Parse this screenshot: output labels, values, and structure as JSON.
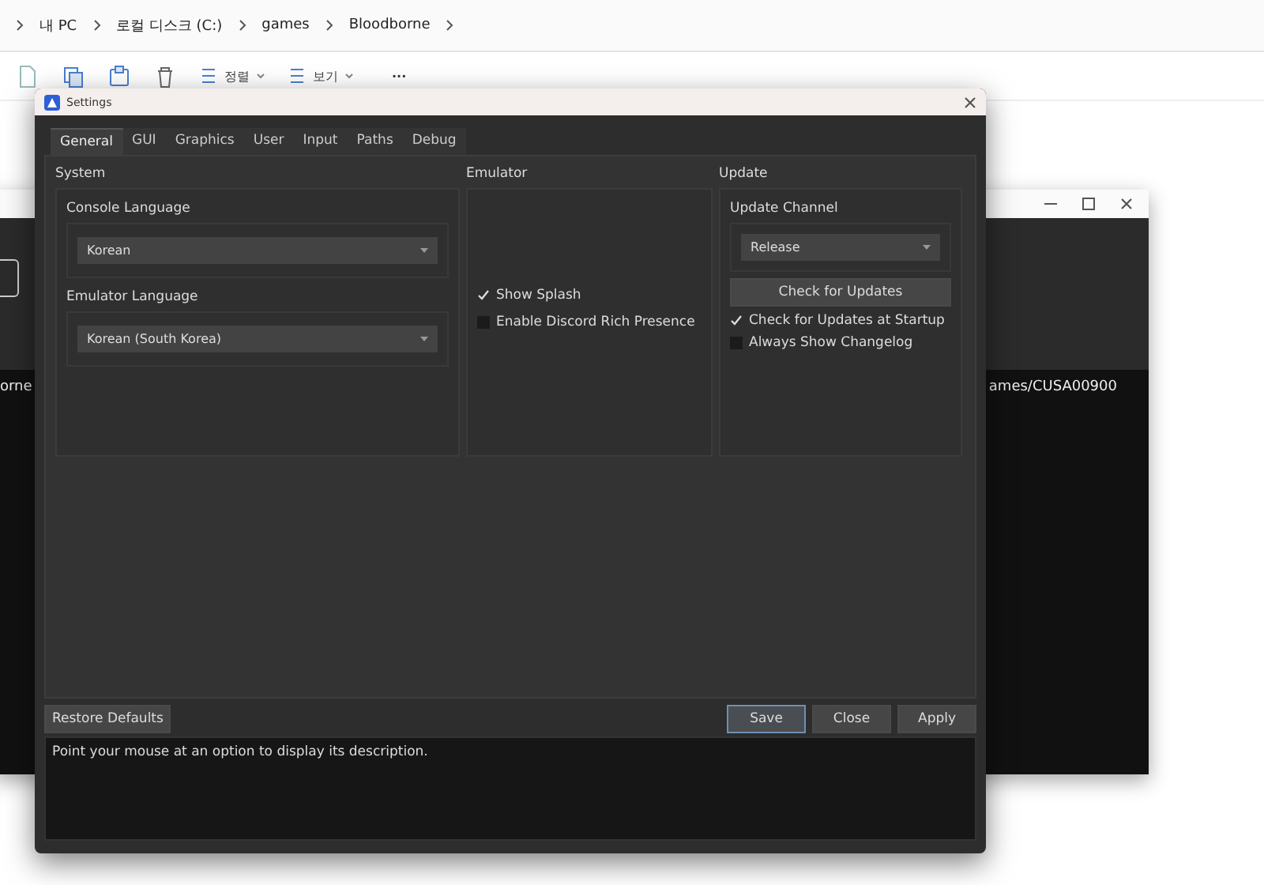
{
  "explorer": {
    "breadcrumb": [
      "내 PC",
      "로컬 디스크 (C:)",
      "games",
      "Bloodborne"
    ],
    "toolbar": [
      {
        "kind": "new"
      },
      {
        "kind": "copy"
      },
      {
        "kind": "paste"
      },
      {
        "kind": "delete"
      },
      {
        "kind": "menu",
        "label": "정렬"
      },
      {
        "kind": "menu",
        "label": "보기"
      },
      {
        "kind": "more",
        "label": "···"
      }
    ]
  },
  "background_window": {
    "texts": [
      "orne",
      "ames/CUSA00900"
    ]
  },
  "settings": {
    "title": "Settings",
    "tabs": [
      {
        "label": "General",
        "selected": true
      },
      {
        "label": "GUI",
        "selected": false
      },
      {
        "label": "Graphics",
        "selected": false
      },
      {
        "label": "User",
        "selected": false
      },
      {
        "label": "Input",
        "selected": false
      },
      {
        "label": "Paths",
        "selected": false
      },
      {
        "label": "Debug",
        "selected": false
      }
    ],
    "system": {
      "title": "System",
      "console_language": {
        "label": "Console Language",
        "value": "Korean"
      },
      "emulator_language": {
        "label": "Emulator Language",
        "value": "Korean (South Korea)"
      }
    },
    "emulator": {
      "title": "Emulator",
      "options": [
        {
          "label": "Show Splash",
          "checked": true
        },
        {
          "label": "Enable Discord Rich Presence",
          "checked": false
        }
      ]
    },
    "update": {
      "title": "Update",
      "channel": {
        "label": "Update Channel",
        "value": "Release"
      },
      "check_button": "Check for Updates",
      "options": [
        {
          "label": "Check for Updates at Startup",
          "checked": true
        },
        {
          "label": "Always Show Changelog",
          "checked": false
        }
      ]
    },
    "restore_button": "Restore Defaults",
    "buttons": [
      {
        "label": "Save",
        "default": true
      },
      {
        "label": "Close",
        "default": false
      },
      {
        "label": "Apply",
        "default": false
      }
    ],
    "description": "Point your mouse at an option to display its description."
  }
}
